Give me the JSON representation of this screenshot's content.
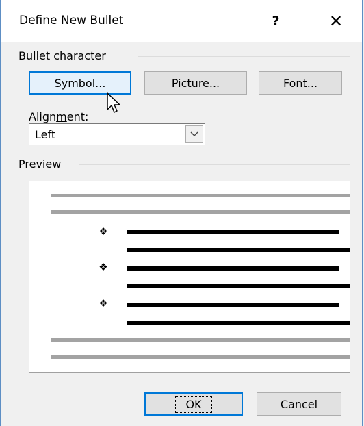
{
  "window": {
    "title": "Define New Bullet",
    "help_label": "?",
    "close_label": "✕"
  },
  "bullet_character": {
    "group_label": "Bullet character",
    "symbol_button": {
      "pre": "",
      "accel": "S",
      "post": "ymbol..."
    },
    "picture_button": {
      "pre": "",
      "accel": "P",
      "post": "icture..."
    },
    "font_button": {
      "pre": "",
      "accel": "F",
      "post": "ont..."
    }
  },
  "alignment": {
    "label": {
      "pre": "Align",
      "accel": "m",
      "post": "ent:"
    },
    "value": "Left"
  },
  "preview": {
    "group_label": "Preview",
    "bullet_glyph": "❖"
  },
  "footer": {
    "ok_label": "OK",
    "cancel_label": "Cancel"
  }
}
